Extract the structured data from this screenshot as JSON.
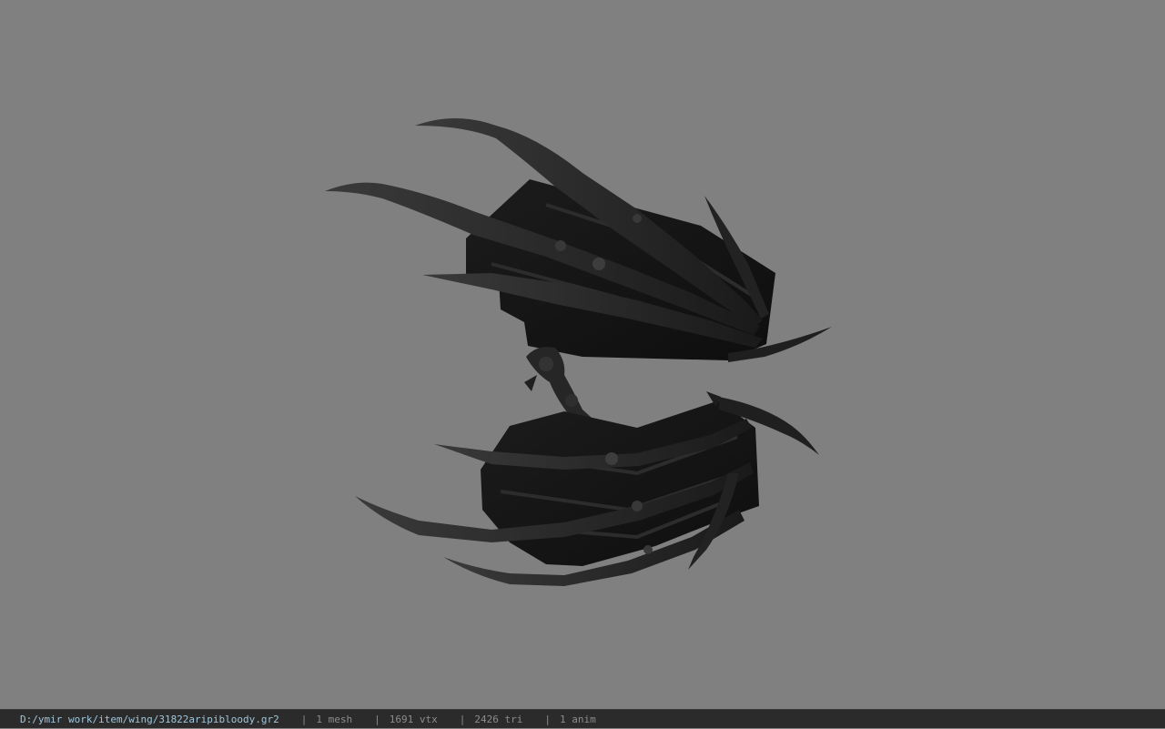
{
  "viewer": {
    "background_color": "#808080",
    "model_icon": "bat-wings-model-icon"
  },
  "statusbar": {
    "file_path": "D:/ymir work/item/wing/31822aripibloody.gr2",
    "separator": "|",
    "mesh_count": "1 mesh",
    "vertex_count": "1691 vtx",
    "triangle_count": "2426 tri",
    "anim_count": "1 anim",
    "path_color": "#9fc6da",
    "bar_color": "#2b2b2b"
  }
}
